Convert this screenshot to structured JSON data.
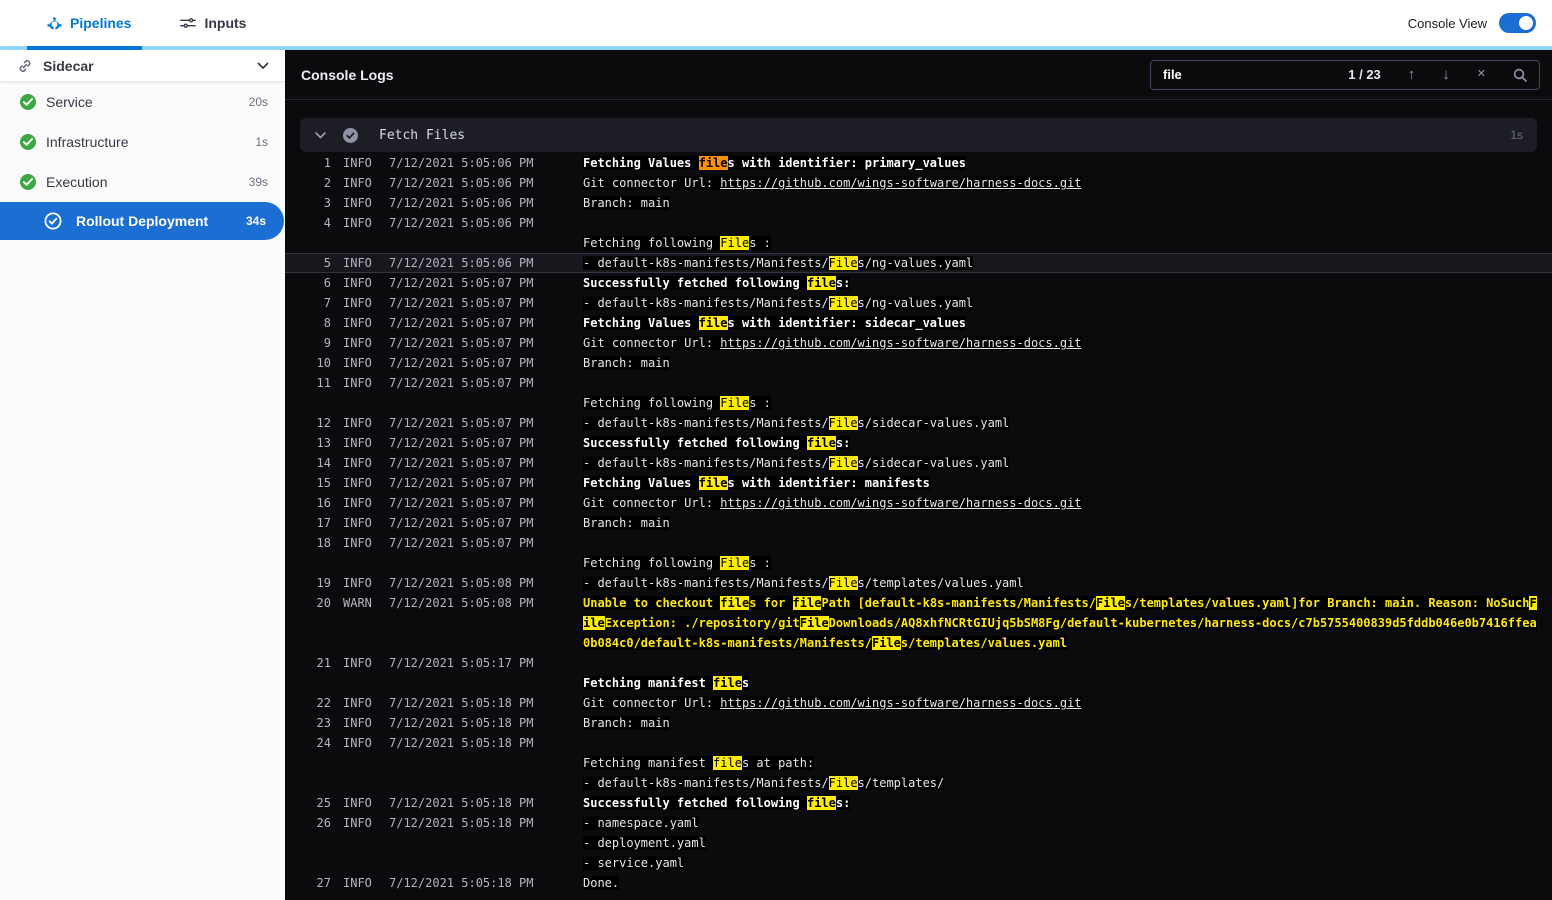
{
  "colors": {
    "primary_blue": "#0278d5",
    "selected_blue": "#1b6fd3",
    "success_green": "#3fa843",
    "topbar_accent": "#8ed6f2",
    "console_bg": "#0b0b0d",
    "match_yellow": "#ffee00",
    "current_match_orange": "#ff9100",
    "warn_yellow": "#ffe512"
  },
  "topbar": {
    "tabs": [
      {
        "label": "Pipelines"
      },
      {
        "label": "Inputs"
      }
    ],
    "console_view_label": "Console View",
    "console_view_on": true
  },
  "sidebar": {
    "title": "Sidecar",
    "items": [
      {
        "label": "Service",
        "duration": "20s",
        "state": "success",
        "selected": false,
        "sub": false
      },
      {
        "label": "Infrastructure",
        "duration": "1s",
        "state": "success",
        "selected": false,
        "sub": false
      },
      {
        "label": "Execution",
        "duration": "39s",
        "state": "success",
        "selected": false,
        "sub": false
      },
      {
        "label": "Rollout Deployment",
        "duration": "34s",
        "state": "success",
        "selected": true,
        "sub": true
      }
    ]
  },
  "console": {
    "title": "Console Logs",
    "search": {
      "value": "file",
      "counter": "1 / 23",
      "prev_icon": "↑",
      "next_icon": "↓",
      "clear_icon": "✕"
    },
    "section": {
      "title": "Fetch Files",
      "duration": "1s"
    }
  },
  "logs": {
    "rows": [
      {
        "num": "1",
        "level": "INFO",
        "time": "7/12/2021 5:05:06 PM",
        "bold": true,
        "segments": [
          {
            "text": "Fetching Values "
          },
          {
            "text": "file",
            "hl": "current"
          },
          {
            "text": "s with identifier: primary_values"
          }
        ]
      },
      {
        "num": "2",
        "level": "INFO",
        "time": "7/12/2021 5:05:06 PM",
        "segments": [
          {
            "text": "Git connector Url: "
          },
          {
            "text": "https://github.com/wings-software/harness-docs.git",
            "link": true
          }
        ]
      },
      {
        "num": "3",
        "level": "INFO",
        "time": "7/12/2021 5:05:06 PM",
        "segments": [
          {
            "text": "Branch: main"
          }
        ]
      },
      {
        "num": "4",
        "level": "INFO",
        "time": "7/12/2021 5:05:06 PM",
        "segments": []
      },
      {
        "segments": [
          {
            "text": "Fetching following "
          },
          {
            "text": "File",
            "hl": "match"
          },
          {
            "text": "s :"
          }
        ]
      },
      {
        "num": "5",
        "level": "INFO",
        "time": "7/12/2021 5:05:06 PM",
        "selected": true,
        "segments": [
          {
            "text": "- default-k8s-manifests/Manifests/"
          },
          {
            "text": "File",
            "hl": "match"
          },
          {
            "text": "s/ng-values.yaml"
          }
        ]
      },
      {
        "num": "6",
        "level": "INFO",
        "time": "7/12/2021 5:05:07 PM",
        "bold": true,
        "segments": [
          {
            "text": "Successfully fetched following "
          },
          {
            "text": "file",
            "hl": "match"
          },
          {
            "text": "s:"
          }
        ]
      },
      {
        "num": "7",
        "level": "INFO",
        "time": "7/12/2021 5:05:07 PM",
        "segments": [
          {
            "text": "- default-k8s-manifests/Manifests/"
          },
          {
            "text": "File",
            "hl": "match"
          },
          {
            "text": "s/ng-values.yaml"
          }
        ]
      },
      {
        "num": "8",
        "level": "INFO",
        "time": "7/12/2021 5:05:07 PM",
        "bold": true,
        "segments": [
          {
            "text": "Fetching Values "
          },
          {
            "text": "file",
            "hl": "match"
          },
          {
            "text": "s with identifier: sidecar_values"
          }
        ]
      },
      {
        "num": "9",
        "level": "INFO",
        "time": "7/12/2021 5:05:07 PM",
        "segments": [
          {
            "text": "Git connector Url: "
          },
          {
            "text": "https://github.com/wings-software/harness-docs.git",
            "link": true
          }
        ]
      },
      {
        "num": "10",
        "level": "INFO",
        "time": "7/12/2021 5:05:07 PM",
        "segments": [
          {
            "text": "Branch: main"
          }
        ]
      },
      {
        "num": "11",
        "level": "INFO",
        "time": "7/12/2021 5:05:07 PM",
        "segments": []
      },
      {
        "segments": [
          {
            "text": "Fetching following "
          },
          {
            "text": "File",
            "hl": "match"
          },
          {
            "text": "s :"
          }
        ]
      },
      {
        "num": "12",
        "level": "INFO",
        "time": "7/12/2021 5:05:07 PM",
        "segments": [
          {
            "text": "- default-k8s-manifests/Manifests/"
          },
          {
            "text": "File",
            "hl": "match"
          },
          {
            "text": "s/sidecar-values.yaml"
          }
        ]
      },
      {
        "num": "13",
        "level": "INFO",
        "time": "7/12/2021 5:05:07 PM",
        "bold": true,
        "segments": [
          {
            "text": "Successfully fetched following "
          },
          {
            "text": "file",
            "hl": "match"
          },
          {
            "text": "s:"
          }
        ]
      },
      {
        "num": "14",
        "level": "INFO",
        "time": "7/12/2021 5:05:07 PM",
        "segments": [
          {
            "text": "- default-k8s-manifests/Manifests/"
          },
          {
            "text": "File",
            "hl": "match"
          },
          {
            "text": "s/sidecar-values.yaml"
          }
        ]
      },
      {
        "num": "15",
        "level": "INFO",
        "time": "7/12/2021 5:05:07 PM",
        "bold": true,
        "segments": [
          {
            "text": "Fetching Values "
          },
          {
            "text": "file",
            "hl": "match"
          },
          {
            "text": "s with identifier: manifests"
          }
        ]
      },
      {
        "num": "16",
        "level": "INFO",
        "time": "7/12/2021 5:05:07 PM",
        "segments": [
          {
            "text": "Git connector Url: "
          },
          {
            "text": "https://github.com/wings-software/harness-docs.git",
            "link": true
          }
        ]
      },
      {
        "num": "17",
        "level": "INFO",
        "time": "7/12/2021 5:05:07 PM",
        "segments": [
          {
            "text": "Branch: main"
          }
        ]
      },
      {
        "num": "18",
        "level": "INFO",
        "time": "7/12/2021 5:05:07 PM",
        "segments": []
      },
      {
        "segments": [
          {
            "text": "Fetching following "
          },
          {
            "text": "File",
            "hl": "match"
          },
          {
            "text": "s :"
          }
        ]
      },
      {
        "num": "19",
        "level": "INFO",
        "time": "7/12/2021 5:05:08 PM",
        "segments": [
          {
            "text": "- default-k8s-manifests/Manifests/"
          },
          {
            "text": "File",
            "hl": "match"
          },
          {
            "text": "s/templates/values.yaml"
          }
        ]
      },
      {
        "num": "20",
        "level": "WARN",
        "time": "7/12/2021 5:05:08 PM",
        "warn": true,
        "segments": [
          {
            "text": "Unable to checkout "
          },
          {
            "text": "file",
            "hl": "match"
          },
          {
            "text": "s for "
          },
          {
            "text": "file",
            "hl": "match"
          },
          {
            "text": "Path [default-k8s-manifests/Manifests/"
          },
          {
            "text": "File",
            "hl": "match"
          },
          {
            "text": "s/templates/values.yaml]for Branch: main. Reason: NoSuch"
          },
          {
            "text": "F",
            "hl": "match"
          }
        ]
      },
      {
        "warn": true,
        "segments": [
          {
            "text": "ile",
            "hl": "match"
          },
          {
            "text": "Exception: ./repository/git"
          },
          {
            "text": "File",
            "hl": "match"
          },
          {
            "text": "Downloads/AQ8xhfNCRtGIUjq5bSM8Fg/default-kubernetes/harness-docs/c7b5755400839d5fddb046e0b7416ffea"
          }
        ]
      },
      {
        "warn": true,
        "segments": [
          {
            "text": "0b084c0/default-k8s-manifests/Manifests/"
          },
          {
            "text": "File",
            "hl": "match"
          },
          {
            "text": "s/templates/values.yaml"
          }
        ]
      },
      {
        "num": "21",
        "level": "INFO",
        "time": "7/12/2021 5:05:17 PM",
        "segments": []
      },
      {
        "bold": true,
        "segments": [
          {
            "text": "Fetching manifest "
          },
          {
            "text": "file",
            "hl": "match"
          },
          {
            "text": "s"
          }
        ]
      },
      {
        "num": "22",
        "level": "INFO",
        "time": "7/12/2021 5:05:18 PM",
        "segments": [
          {
            "text": "Git connector Url: "
          },
          {
            "text": "https://github.com/wings-software/harness-docs.git",
            "link": true
          }
        ]
      },
      {
        "num": "23",
        "level": "INFO",
        "time": "7/12/2021 5:05:18 PM",
        "segments": [
          {
            "text": "Branch: main"
          }
        ]
      },
      {
        "num": "24",
        "level": "INFO",
        "time": "7/12/2021 5:05:18 PM",
        "segments": []
      },
      {
        "segments": [
          {
            "text": "Fetching manifest "
          },
          {
            "text": "file",
            "hl": "match"
          },
          {
            "text": "s at path:"
          }
        ]
      },
      {
        "segments": [
          {
            "text": "- default-k8s-manifests/Manifests/"
          },
          {
            "text": "File",
            "hl": "match"
          },
          {
            "text": "s/templates/"
          }
        ]
      },
      {
        "num": "25",
        "level": "INFO",
        "time": "7/12/2021 5:05:18 PM",
        "bold": true,
        "segments": [
          {
            "text": "Successfully fetched following "
          },
          {
            "text": "file",
            "hl": "match"
          },
          {
            "text": "s:"
          }
        ]
      },
      {
        "num": "26",
        "level": "INFO",
        "time": "7/12/2021 5:05:18 PM",
        "segments": [
          {
            "text": "- namespace.yaml"
          }
        ]
      },
      {
        "segments": [
          {
            "text": "- deployment.yaml"
          }
        ]
      },
      {
        "segments": [
          {
            "text": "- service.yaml"
          }
        ]
      },
      {
        "num": "27",
        "level": "INFO",
        "time": "7/12/2021 5:05:18 PM",
        "segments": [
          {
            "text": "Done."
          }
        ]
      }
    ]
  }
}
